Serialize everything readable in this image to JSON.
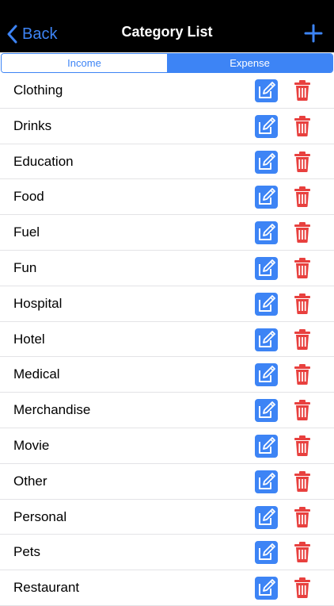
{
  "nav": {
    "back_label": "Back",
    "title": "Category List",
    "add_icon": "plus-icon"
  },
  "segment": {
    "options": [
      "Income",
      "Expense"
    ],
    "selected": "Expense"
  },
  "categories": [
    "Clothing",
    "Drinks",
    "Education",
    "Food",
    "Fuel",
    "Fun",
    "Hospital",
    "Hotel",
    "Medical",
    "Merchandise",
    "Movie",
    "Other",
    "Personal",
    "Pets",
    "Restaurant"
  ],
  "icons": {
    "edit": "edit-pencil-icon",
    "delete": "trash-icon"
  },
  "colors": {
    "accent": "#3d84f5",
    "delete": "#e8403e",
    "nav_background": "#000000"
  }
}
